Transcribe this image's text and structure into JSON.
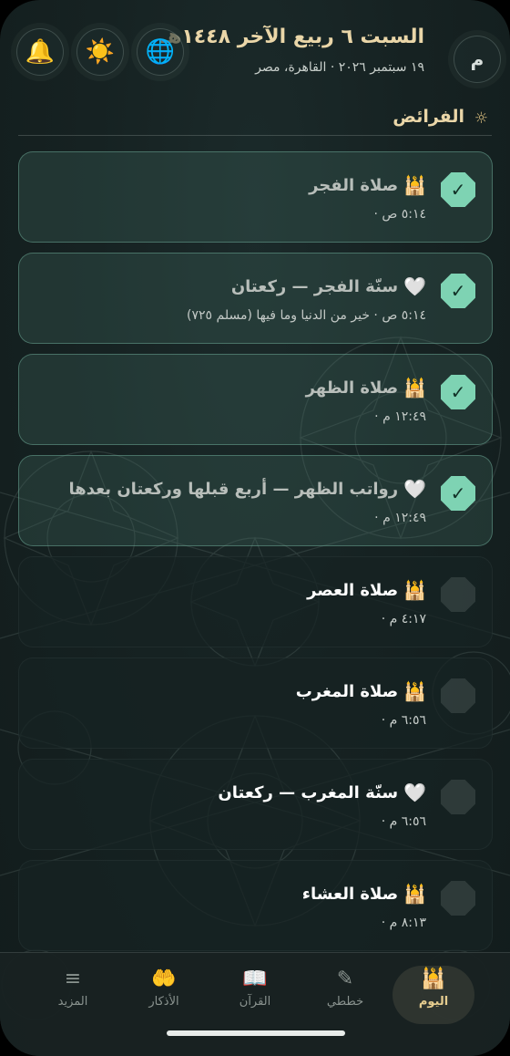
{
  "header": {
    "hijri_date": "السبت ٦ ربيع الآخر ١٤٤٨هـ",
    "sub_line": "١٩ سبتمبر ٢٠٢٦ · القاهرة، مصر",
    "avatar_letter": "م",
    "icons": {
      "globe": "🌐",
      "sun": "☀️",
      "bell": "🔔"
    }
  },
  "section": {
    "icon": "☼",
    "title": "الفرائض"
  },
  "prayers": [
    {
      "status": "done",
      "icon": "🕌",
      "title": "صلاة الفجر",
      "subtitle": "٥:١٤ ص ·",
      "check": "✓"
    },
    {
      "status": "done",
      "icon": "🤍",
      "title": "سنّة الفجر — ركعتان",
      "subtitle": "٥:١٤ ص · خير من الدنيا وما فيها (مسلم ٧٢٥)",
      "check": "✓"
    },
    {
      "status": "done",
      "icon": "🕌",
      "title": "صلاة الظهر",
      "subtitle": "١٢:٤٩ م ·",
      "check": "✓"
    },
    {
      "status": "done",
      "icon": "🤍",
      "title": "رواتب الظهر — أربع قبلها وركعتان بعدها",
      "subtitle": "١٢:٤٩ م ·",
      "check": "✓"
    },
    {
      "status": "pending",
      "icon": "🕌",
      "title": "صلاة العصر",
      "subtitle": "٤:١٧ م ·",
      "check": ""
    },
    {
      "status": "pending",
      "icon": "🕌",
      "title": "صلاة المغرب",
      "subtitle": "٦:٥٦ م ·",
      "check": ""
    },
    {
      "status": "pending",
      "icon": "🤍",
      "title": "سنّة المغرب — ركعتان",
      "subtitle": "٦:٥٦ م ·",
      "check": ""
    },
    {
      "status": "pending",
      "icon": "🕌",
      "title": "صلاة العشاء",
      "subtitle": "٨:١٣ م ·",
      "check": ""
    }
  ],
  "nav": {
    "today": {
      "label": "اليوم",
      "icon": "🕌"
    },
    "plans": {
      "label": "خططي",
      "icon": "✎"
    },
    "quran": {
      "label": "القرآن",
      "icon": "📖"
    },
    "adhkar": {
      "label": "الأذكار",
      "icon": "🤲"
    },
    "more": {
      "label": "المزيد",
      "icon": "≡"
    },
    "active": "today"
  }
}
